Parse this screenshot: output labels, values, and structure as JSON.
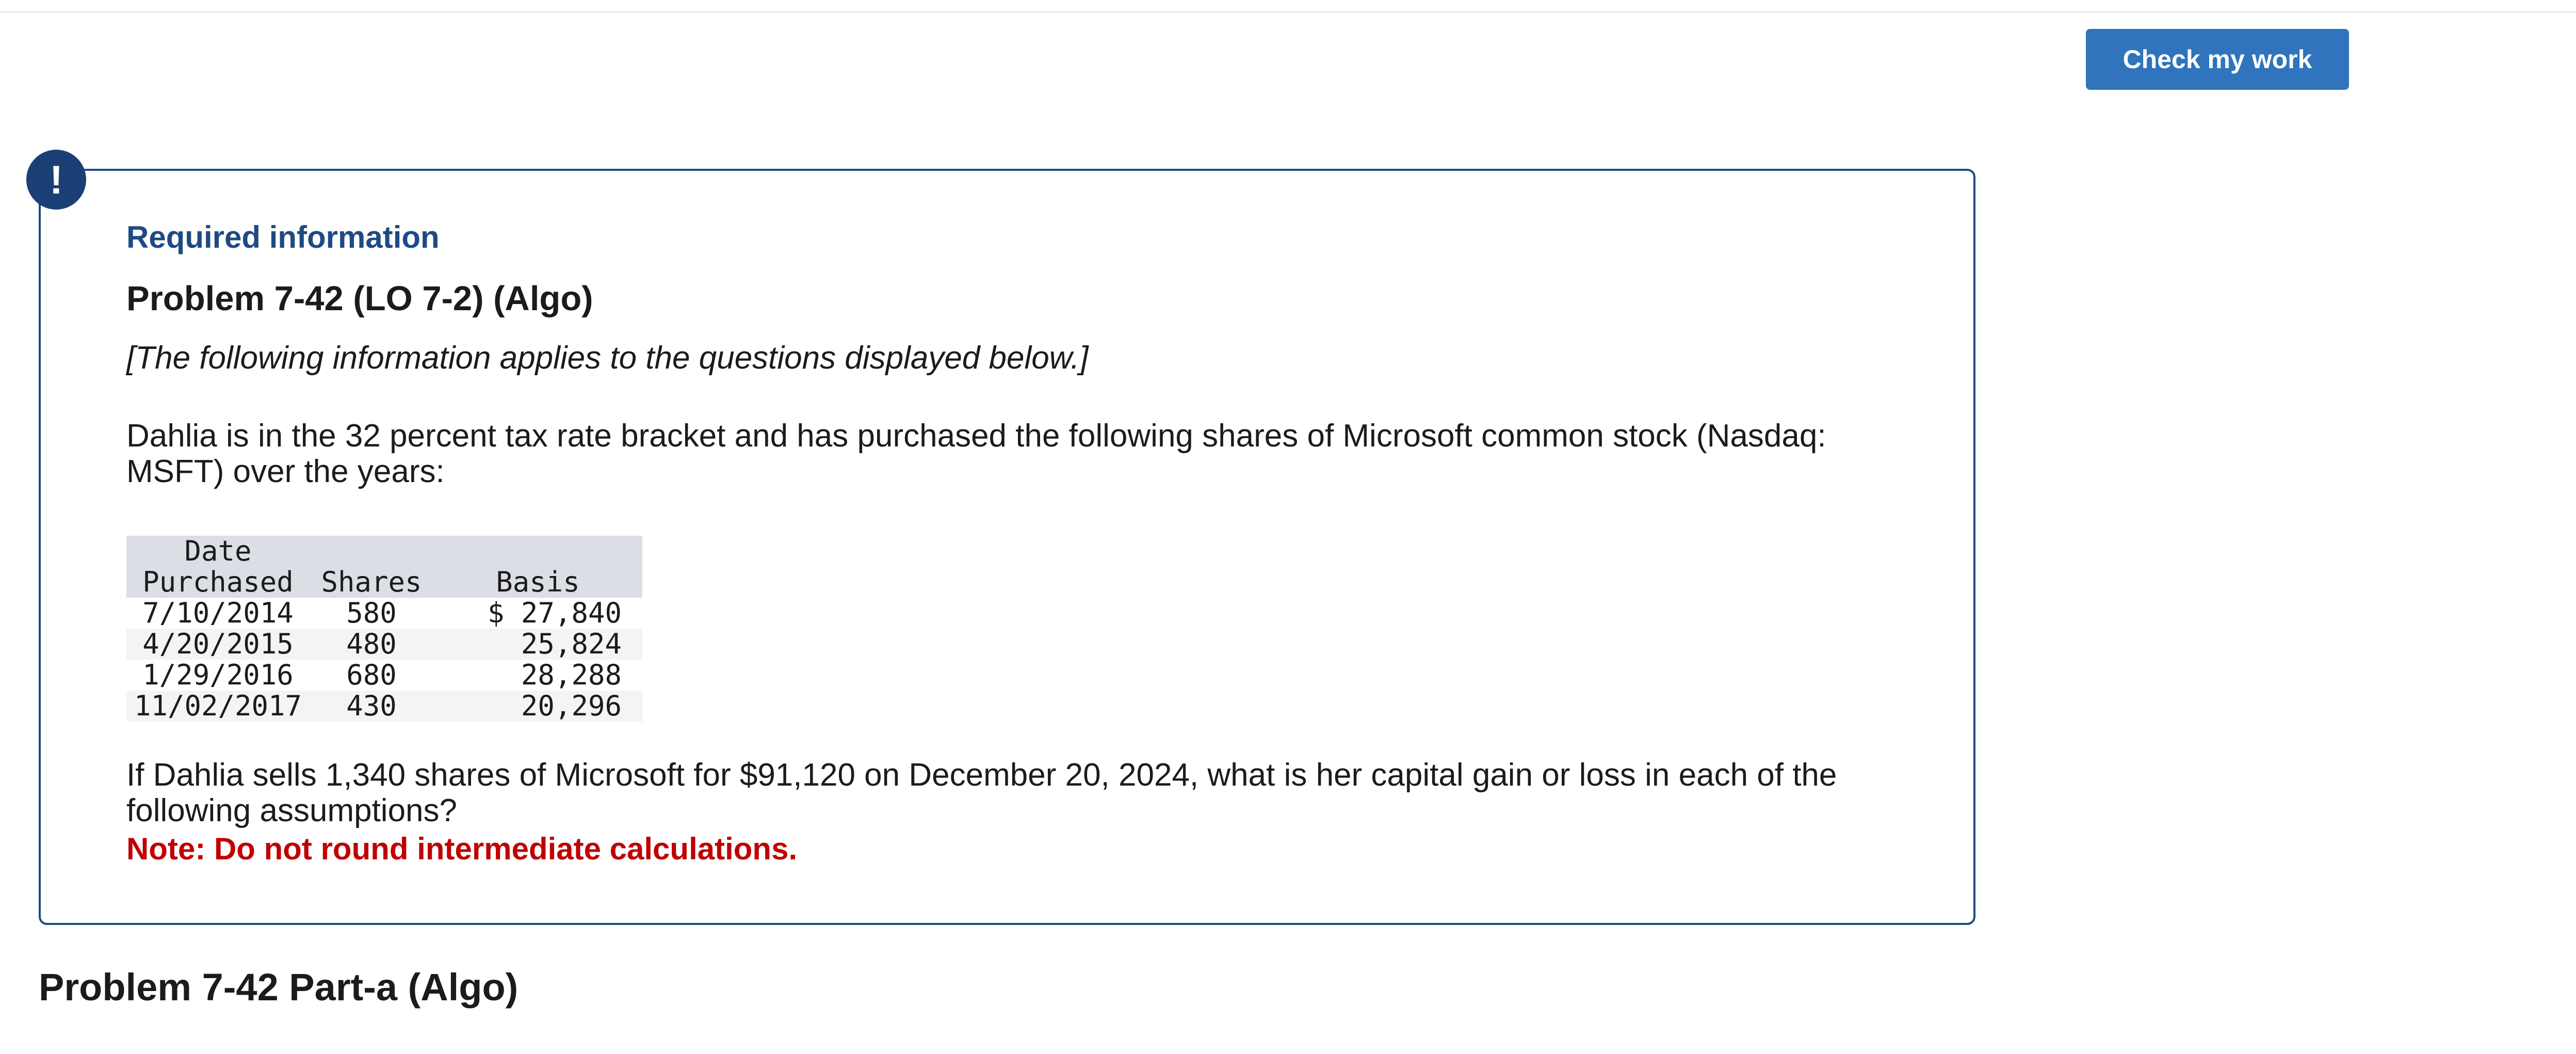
{
  "header": {
    "check_button_label": "Check my work"
  },
  "info_box": {
    "badge_symbol": "!",
    "required_label": "Required information",
    "problem_title": "Problem 7-42 (LO 7-2) (Algo)",
    "applies_note": "[The following information applies to the questions displayed below.]",
    "intro_text": "Dahlia is in the 32 percent tax rate bracket and has purchased the following shares of Microsoft common stock (Nasdaq: MSFT) over the years:",
    "table": {
      "headers": {
        "date_line1": "Date",
        "date_line2": "Purchased",
        "shares": "Shares",
        "basis": "Basis"
      },
      "rows": [
        {
          "date": "7/10/2014",
          "shares": "580",
          "basis": "$ 27,840"
        },
        {
          "date": "4/20/2015",
          "shares": "480",
          "basis": "25,824"
        },
        {
          "date": "1/29/2016",
          "shares": "680",
          "basis": "28,288"
        },
        {
          "date": "11/02/2017",
          "shares": "430",
          "basis": "20,296"
        }
      ]
    },
    "question_text": "If Dahlia sells 1,340 shares of Microsoft for $91,120 on December 20, 2024, what is her capital gain or loss in each of the following assumptions?",
    "note_text": "Note: Do not round intermediate calculations."
  },
  "part": {
    "title": "Problem 7-42 Part-a (Algo)"
  },
  "colors": {
    "accent_blue": "#2f74bd",
    "border_navy": "#1e4a82",
    "note_red": "#c00000"
  }
}
